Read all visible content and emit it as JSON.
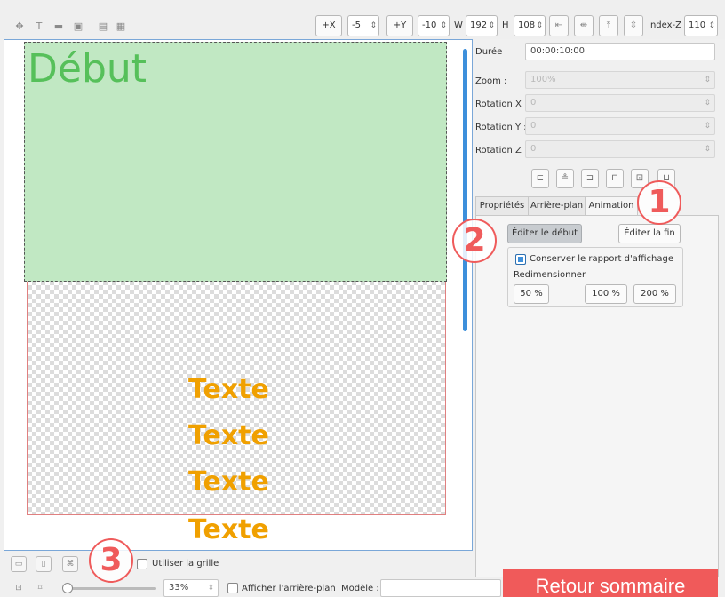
{
  "toolbar": {
    "tools": [
      "move-tool-icon",
      "text-tool-icon",
      "rect-tool-icon",
      "image-tool-icon",
      "open-icon",
      "save-icon"
    ],
    "plus_x": "+X",
    "x_value": "-5",
    "plus_y": "+Y",
    "y_value": "-10",
    "w_label": "W",
    "w_value": "192",
    "h_label": "H",
    "h_value": "108",
    "index_z_label": "Index-Z",
    "index_z_value": "110"
  },
  "canvas": {
    "start_text": "Début",
    "text_items": [
      "Texte",
      "Texte",
      "Texte",
      "Texte"
    ]
  },
  "panel": {
    "duree_label": "Durée",
    "duree_value": "00:00:10:00",
    "zoom_label": "Zoom :",
    "zoom_value": "100%",
    "rotx_label": "Rotation X :",
    "rotx_value": "0",
    "roty_label": "Rotation Y :",
    "roty_value": "0",
    "rotz_label": "Rotation Z :",
    "rotz_value": "0",
    "tabs": [
      {
        "label": "Propriétés"
      },
      {
        "label": "Arrière-plan"
      },
      {
        "label": "Animation"
      }
    ],
    "edit_start": "Éditer le début",
    "edit_end": "Éditer la fin",
    "keep_ratio": "Conserver le rapport d'affichage",
    "resize_label": "Redimensionner",
    "resize_buttons": [
      "50 %",
      "100 %",
      "200 %"
    ]
  },
  "bottom": {
    "use_grid": "Utiliser la grille",
    "zoom_value": "33%",
    "show_background": "Afficher l'arrière-plan",
    "template_label": "Modèle :"
  },
  "overlay": {
    "badges": [
      "1",
      "2",
      "3"
    ],
    "return_button": "Retour sommaire",
    "accent_color": "#f05a5a"
  }
}
